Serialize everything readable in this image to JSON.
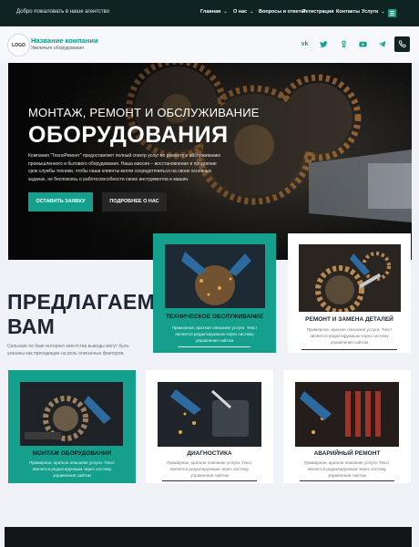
{
  "topbar": {
    "welcome": "Добро пожаловать в наше агентство",
    "nav": [
      {
        "label": "Главная",
        "dropdown": true
      },
      {
        "label": "О нас",
        "dropdown": true
      },
      {
        "label": "Вопросы и ответы",
        "dropdown": false
      },
      {
        "label": "Регистрация",
        "dropdown": false
      },
      {
        "label": "Контакты",
        "dropdown": false
      },
      {
        "label": "Услуги",
        "dropdown": true
      }
    ],
    "menu_icon": "hamburger-icon"
  },
  "header": {
    "logo": "LOGO",
    "company_name": "Название компании",
    "company_sub": "Увеличьте оборудования",
    "social": [
      "vk-icon",
      "twitter-icon",
      "odnoklassniki-icon",
      "youtube-icon",
      "telegram-icon"
    ],
    "phone_icon": "phone-icon"
  },
  "hero": {
    "eyebrow": "МОНТАЖ, РЕМОНТ И ОБСЛУЖИВАНИЕ",
    "title": "ОБОРУДОВАНИЯ",
    "text": "Компания \"ТехноРемонт\" предоставляет полный спектр услуг по ремонту и обслуживанию промышленного и бытового оборудования. Наша миссия – восстановление и продление срок службы техники, чтобы наши клиенты могли сосредоточиться на своих основных задачах, не беспокоясь о работоспособности своих инструментов и машин.",
    "btn_primary": "ОСТАВИТЬ ЗАЯВКУ",
    "btn_secondary": "ПОДРОБНЕЕ О НАС"
  },
  "offer": {
    "title_line1": "ПРЕДЛАГАЕМ",
    "title_line2": "ВАМ",
    "text": "Сельские по базе интернет-агентства выводы могут быть указаны как преходящие на роль описанных факторов."
  },
  "cards": [
    {
      "title": "ТЕХНИЧЕСКОЕ ОБСЛУЖИВАНИЕ",
      "text": "Примерное, краткое описание услуги. Текст является редактируемым через систему управления сайтом",
      "teal": true
    },
    {
      "title": "РЕМОНТ И ЗАМЕНА ДЕТАЛЕЙ",
      "text": "Примерное, краткое описание услуги. Текст является редактируемым через систему управления сайтом",
      "teal": false
    },
    {
      "title": "МОНТАЖ ОБОРУДОВАНИЯ",
      "text": "Примерное, краткое описание услуги. Текст является редактируемым через систему управления сайтом",
      "teal": true
    },
    {
      "title": "ДИАГНОСТИКА",
      "text": "Примерное, краткое описание услуги. Текст является редактируемым через систему управления сайтом",
      "teal": false
    },
    {
      "title": "АВАРИЙНЫЙ РЕМОНТ",
      "text": "Примерное, краткое описание услуги. Текст является редактируемым через систему управления сайтом",
      "teal": false
    }
  ],
  "colors": {
    "accent": "#15a08e",
    "dark": "#0f2322",
    "background": "#f0f2f8"
  }
}
